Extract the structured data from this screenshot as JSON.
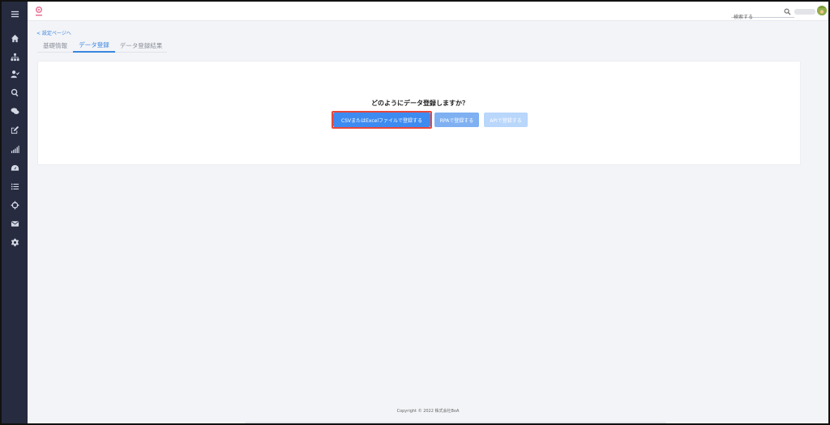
{
  "header": {
    "search": {
      "placeholder": "検索する"
    }
  },
  "nav": {
    "back_link": "< 設定ページへ"
  },
  "tabs": [
    {
      "label": "基礎情報",
      "active": false
    },
    {
      "label": "データ登録",
      "active": true
    },
    {
      "label": "データ登録結果",
      "active": false
    }
  ],
  "main": {
    "question": "どのようにデータ登録しますか？",
    "buttons": {
      "csv": "CSVまたはExcelファイルで登録する",
      "rpa": "RPAで登録する",
      "api": "APIで登録する"
    }
  },
  "footer": {
    "copyright": "Copyright © 2022 株式会社BoA"
  },
  "colors": {
    "sidebar": "#262b40",
    "accent": "#3d8bf0",
    "highlight": "#e8473b"
  },
  "sidebar_icons": [
    "menu-icon",
    "home-icon",
    "org-chart-icon",
    "user-check-icon",
    "search-icon",
    "chat-icon",
    "edit-icon",
    "signal-icon",
    "dashboard-icon",
    "list-icon",
    "crosshair-icon",
    "mail-icon",
    "gear-icon"
  ]
}
